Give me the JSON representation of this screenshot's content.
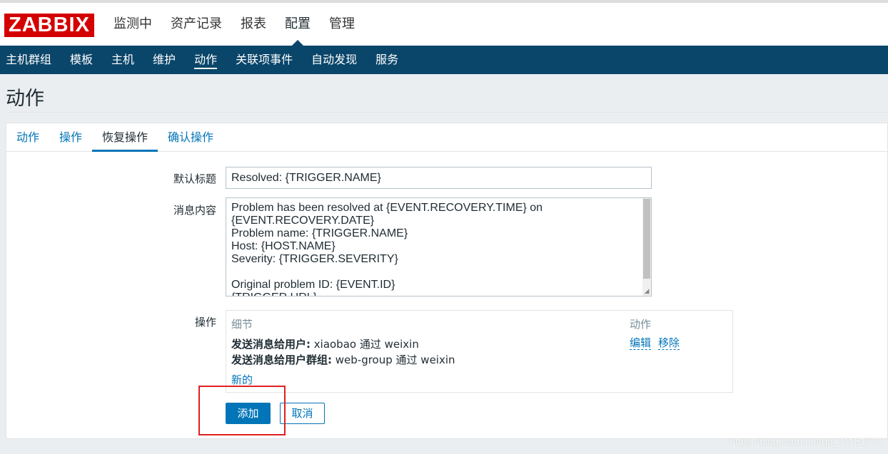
{
  "logo": "ZABBIX",
  "main_nav": [
    "监测中",
    "资产记录",
    "报表",
    "配置",
    "管理"
  ],
  "main_nav_active": "配置",
  "sub_nav": [
    "主机群组",
    "模板",
    "主机",
    "维护",
    "动作",
    "关联项事件",
    "自动发现",
    "服务"
  ],
  "sub_nav_active": "动作",
  "page_title": "动作",
  "tabs": [
    "动作",
    "操作",
    "恢复操作",
    "确认操作"
  ],
  "tab_active": "恢复操作",
  "form": {
    "subject_label": "默认标题",
    "subject_value": "Resolved: {TRIGGER.NAME}",
    "message_label": "消息内容",
    "message_value": "Problem has been resolved at {EVENT.RECOVERY.TIME} on\n{EVENT.RECOVERY.DATE}\nProblem name: {TRIGGER.NAME}\nHost: {HOST.NAME}\nSeverity: {TRIGGER.SEVERITY}\n\nOriginal problem ID: {EVENT.ID}\n{TRIGGER.URL}",
    "operations_label": "操作"
  },
  "operations": {
    "col_details": "细节",
    "col_action": "动作",
    "rows": [
      {
        "bold": "发送消息给用户:",
        "text": " xiaobao 通过 weixin"
      },
      {
        "bold": "发送消息给用户群组:",
        "text": " web-group 通过 weixin"
      }
    ],
    "edit_link": "编辑",
    "remove_link": "移除",
    "new_link": "新的"
  },
  "buttons": {
    "add": "添加",
    "cancel": "取消"
  },
  "watermark": "https://blog.csdn.net/qq_41181772",
  "colors": {
    "brand_red": "#d40000",
    "nav_blue": "#0a466a",
    "link_blue": "#0275b8",
    "highlight_red": "#e02020"
  }
}
